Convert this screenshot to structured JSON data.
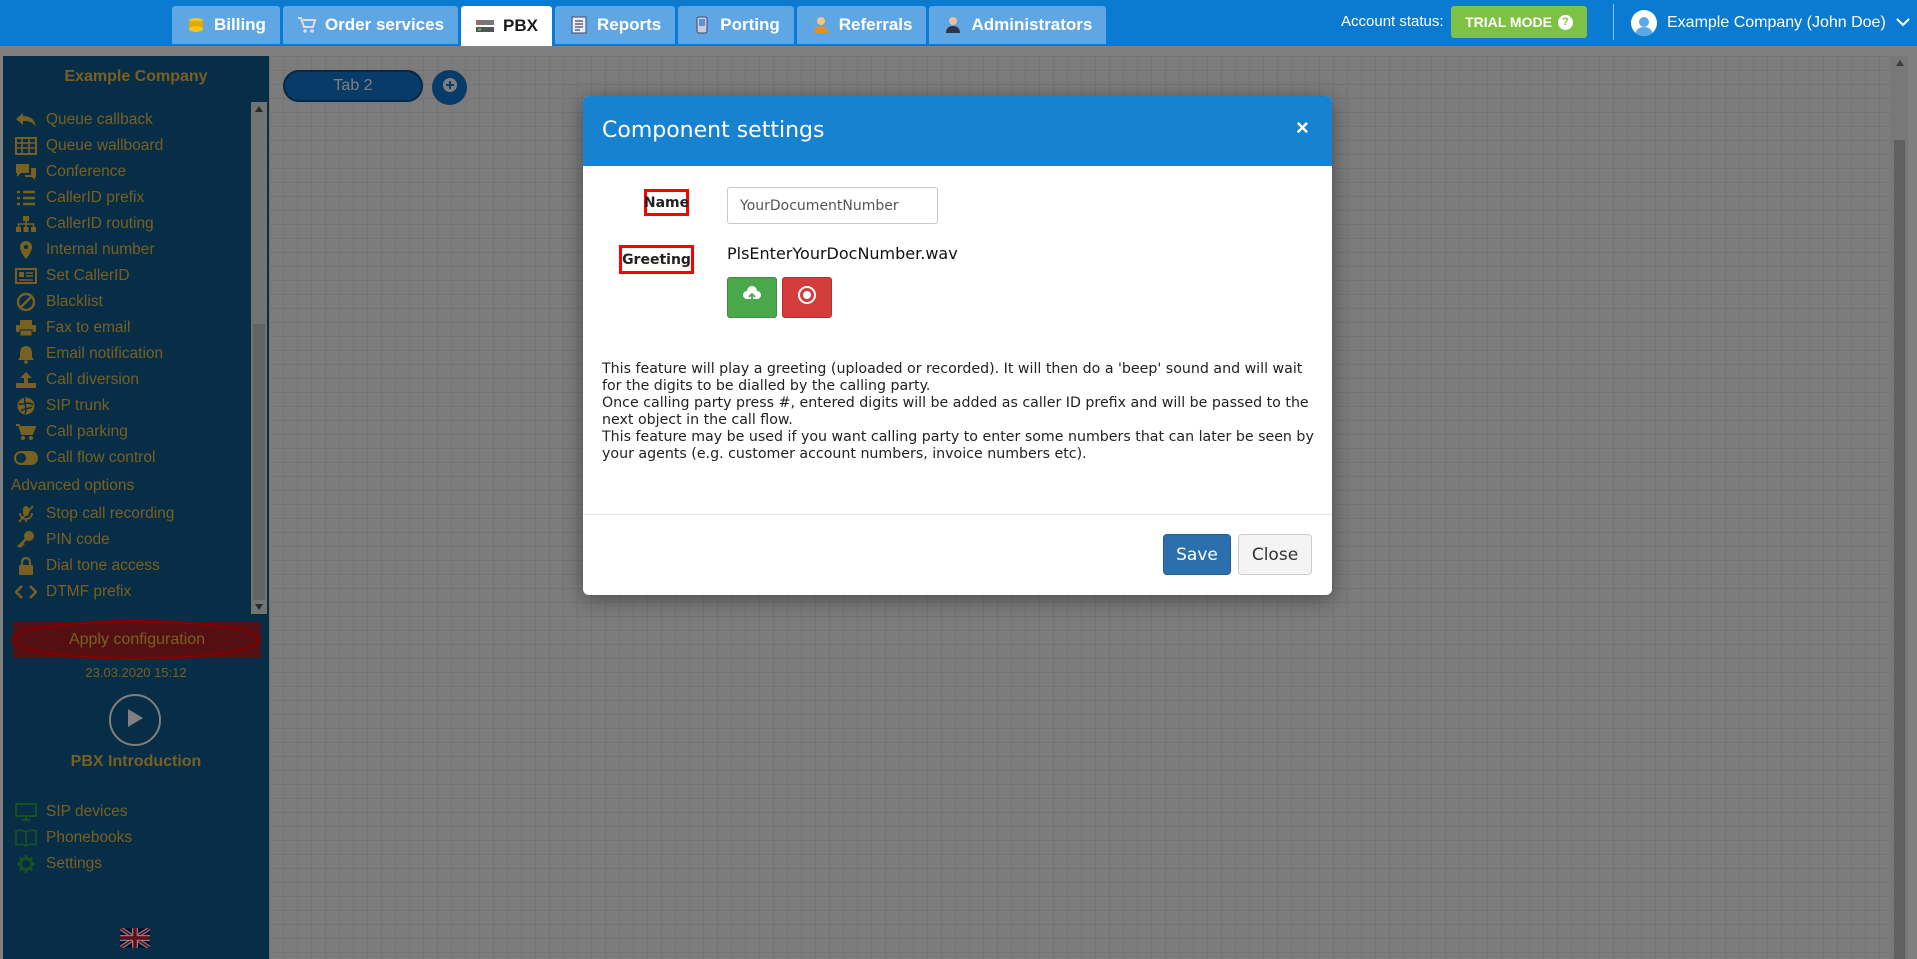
{
  "nav": {
    "tabs": [
      {
        "label": "Billing",
        "icon": "coins-icon"
      },
      {
        "label": "Order services",
        "icon": "cart-icon"
      },
      {
        "label": "PBX",
        "icon": "pbx-icon",
        "active": true
      },
      {
        "label": "Reports",
        "icon": "report-icon"
      },
      {
        "label": "Porting",
        "icon": "phone-icon"
      },
      {
        "label": "Referrals",
        "icon": "person-icon"
      },
      {
        "label": "Administrators",
        "icon": "admin-icon"
      }
    ],
    "account_status_label": "Account status:",
    "trial_button": "TRIAL MODE",
    "user_name": "Example Company (John Doe)"
  },
  "sidebar": {
    "company": "Example Company",
    "items": [
      {
        "label": "Queue callback",
        "icon": "reply-icon"
      },
      {
        "label": "Queue wallboard",
        "icon": "table-icon"
      },
      {
        "label": "Conference",
        "icon": "chat-icon"
      },
      {
        "label": "CallerID prefix",
        "icon": "list-icon"
      },
      {
        "label": "CallerID routing",
        "icon": "sitemap-icon"
      },
      {
        "label": "Internal number",
        "icon": "map-marker-icon"
      },
      {
        "label": "Set CallerID",
        "icon": "id-card-icon"
      },
      {
        "label": "Blacklist",
        "icon": "ban-icon"
      },
      {
        "label": "Fax to email",
        "icon": "printer-icon"
      },
      {
        "label": "Email notification",
        "icon": "bell-icon"
      },
      {
        "label": "Call diversion",
        "icon": "upload-icon"
      },
      {
        "label": "SIP trunk",
        "icon": "network-icon"
      },
      {
        "label": "Call parking",
        "icon": "cart-icon"
      },
      {
        "label": "Call flow control",
        "icon": "toggle-icon"
      }
    ],
    "advanced_heading": "Advanced options",
    "advanced_items": [
      {
        "label": "Stop call recording",
        "icon": "mic-off-icon"
      },
      {
        "label": "PIN code",
        "icon": "key-icon"
      },
      {
        "label": "Dial tone access",
        "icon": "lock-icon"
      },
      {
        "label": "DTMF prefix",
        "icon": "code-icon"
      }
    ],
    "apply_button": "Apply configuration",
    "apply_date": "23.03.2020 15:12",
    "intro_label": "PBX Introduction",
    "bottom_items": [
      {
        "label": "SIP devices",
        "icon": "monitor-icon"
      },
      {
        "label": "Phonebooks",
        "icon": "book-icon"
      },
      {
        "label": "Settings",
        "icon": "gear-icon"
      }
    ]
  },
  "canvas": {
    "tab_label": "Tab 2"
  },
  "modal": {
    "title": "Component settings",
    "close_glyph": "×",
    "name_label": "Name",
    "name_value": "YourDocumentNumber",
    "greeting_label": "Greeting",
    "greeting_file": "PlsEnterYourDocNumber.wav",
    "description": [
      "This feature will play a greeting (uploaded or recorded). It will then do a 'beep' sound and will wait for the digits to be dialled by the calling party.",
      "Once calling party press #, entered digits will be added as caller ID prefix and will be passed to the next object in the call flow.",
      "This feature may be used if you want calling party to enter some numbers that can later be seen by your agents (e.g. customer account numbers, invoice numbers etc)."
    ],
    "save_button": "Save",
    "close_button": "Close"
  },
  "colors": {
    "topbar": "#0b7bd2",
    "sidebar": "#0f5a8f",
    "sidebar_text": "#f0c040",
    "modal_header": "#1782cf",
    "apply_button": "#a81f24",
    "trial_green": "#7dc244",
    "highlight_red": "#ff0000"
  }
}
